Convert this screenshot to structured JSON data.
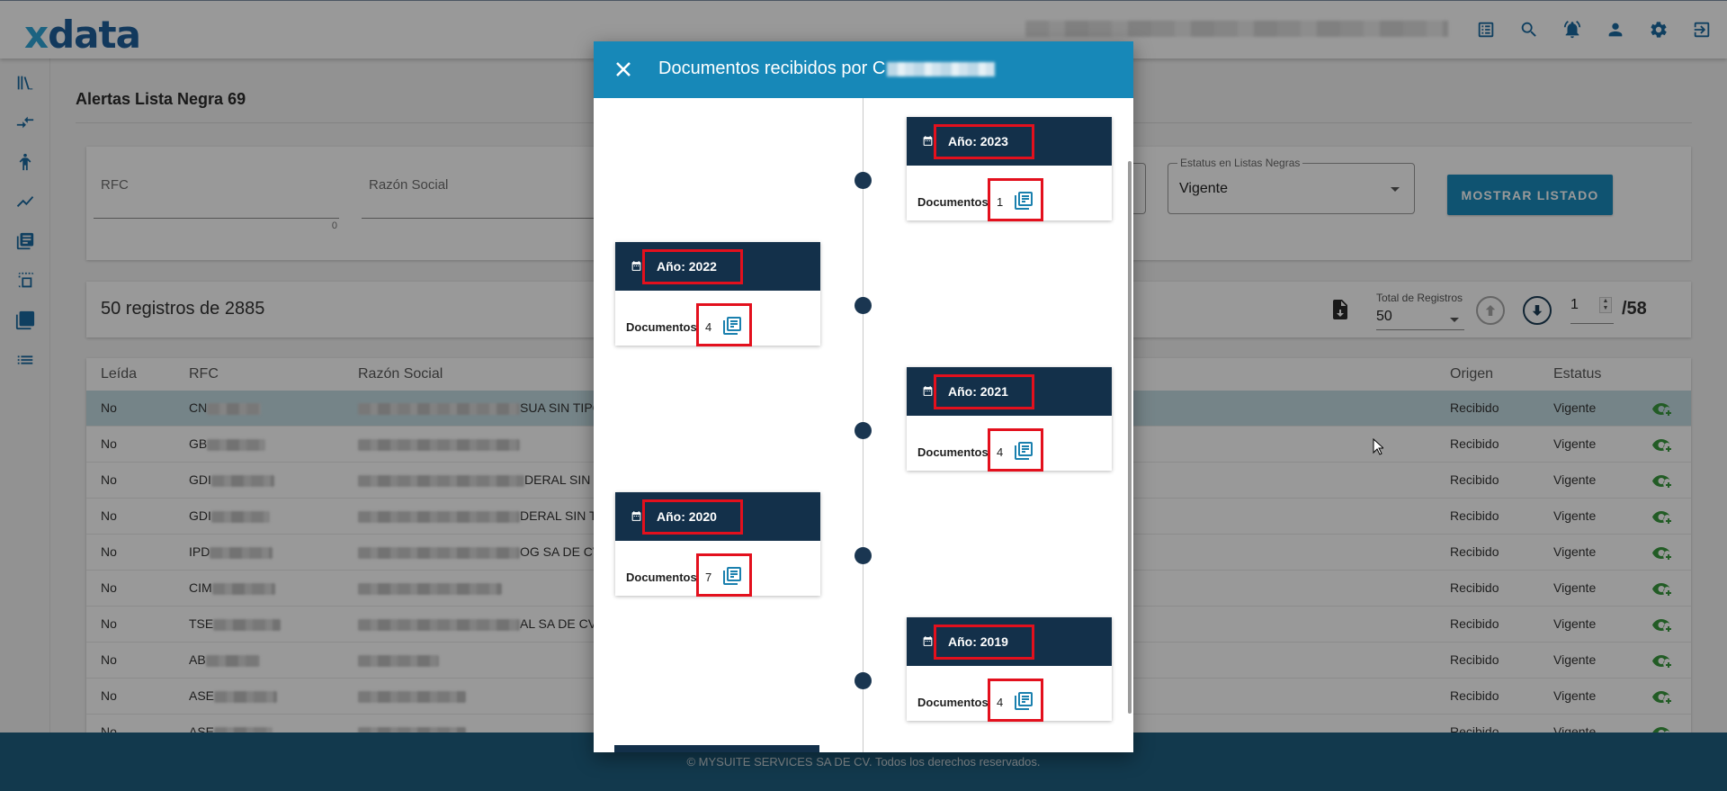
{
  "app": {
    "logo_x": "x",
    "logo_rest": "data"
  },
  "header_icons": [
    "list-alt-icon",
    "search-icon",
    "notification-bell-icon",
    "user-icon",
    "settings-gear-icon",
    "logout-icon"
  ],
  "sidebar_icons": [
    "library-icon",
    "compare-arrows-icon",
    "figure-icon",
    "line-chart-icon",
    "document-list-icon",
    "copy-dashed-icon",
    "layers-icon",
    "list-icon"
  ],
  "page": {
    "title": "Alertas Lista Negra 69"
  },
  "filters": {
    "rfc_label": "RFC",
    "rfc_counter": "0",
    "razon_label": "Razón Social",
    "estatus_label": "Estatus en Listas Negras",
    "estatus_value": "Vigente",
    "show_button": "MOSTRAR LISTADO"
  },
  "summary": {
    "count_text": "50 registros de 2885",
    "total_label": "Total de Registros",
    "total_value": "50",
    "page_value": "1",
    "page_total": "/58"
  },
  "table": {
    "headers": {
      "leida": "Leída",
      "rfc": "RFC",
      "razon": "Razón Social",
      "origen": "Origen",
      "estatus": "Estatus"
    },
    "rows": [
      {
        "leida": "No",
        "rfc": "CN",
        "razon": "SUA SIN TIPO",
        "origen": "Recibido",
        "estatus": "Vigente"
      },
      {
        "leida": "No",
        "rfc": "GB",
        "razon": "",
        "origen": "Recibido",
        "estatus": "Vigente"
      },
      {
        "leida": "No",
        "rfc": "GDI",
        "razon": "DERAL SIN TI",
        "origen": "Recibido",
        "estatus": "Vigente"
      },
      {
        "leida": "No",
        "rfc": "GDI",
        "razon": "DERAL SIN TI",
        "origen": "Recibido",
        "estatus": "Vigente"
      },
      {
        "leida": "No",
        "rfc": "IPD",
        "razon": "OG SA DE CV",
        "origen": "Recibido",
        "estatus": "Vigente"
      },
      {
        "leida": "No",
        "rfc": "CIM",
        "razon": "",
        "origen": "Recibido",
        "estatus": "Vigente"
      },
      {
        "leida": "No",
        "rfc": "TSE",
        "razon": "AL SA DE CV",
        "origen": "Recibido",
        "estatus": "Vigente"
      },
      {
        "leida": "No",
        "rfc": "AB",
        "razon": "",
        "origen": "Recibido",
        "estatus": "Vigente"
      },
      {
        "leida": "No",
        "rfc": "ASE",
        "razon": "",
        "origen": "Recibido",
        "estatus": "Vigente"
      },
      {
        "leida": "No",
        "rfc": "ASE",
        "razon": "",
        "origen": "Recibido",
        "estatus": "Vigente"
      }
    ]
  },
  "modal": {
    "title": "Documentos recibidos por C",
    "documents_label": "Documentos",
    "timeline": [
      {
        "year_label": "Año: 2023",
        "count": "1"
      },
      {
        "year_label": "Año: 2022",
        "count": "4"
      },
      {
        "year_label": "Año: 2021",
        "count": "4"
      },
      {
        "year_label": "Año: 2020",
        "count": "7"
      },
      {
        "year_label": "Año: 2019",
        "count": "4"
      }
    ]
  },
  "footer": {
    "text": "© MYSUITE SERVICES SA DE CV. Todos los derechos reservados."
  },
  "colors": {
    "primary": "#1788b8",
    "dark_navy": "#13304a",
    "highlight_red": "#e3101d",
    "eye_green": "#3a9a3f",
    "footer_bg": "#1e5f80"
  }
}
